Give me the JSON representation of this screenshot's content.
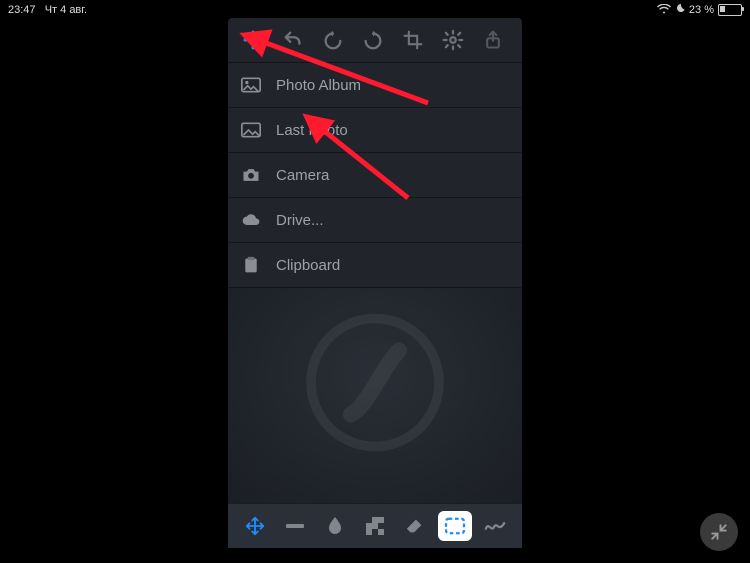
{
  "status": {
    "time": "23:47",
    "date": "Чт 4 авг.",
    "battery_text": "23 %",
    "battery_pct": 23
  },
  "toolbar": {
    "add": "Add",
    "undo": "Undo",
    "redo": "Redo",
    "crop": "Crop",
    "settings": "Settings",
    "share": "Share"
  },
  "menu": {
    "items": [
      {
        "icon": "image",
        "label": "Photo Album"
      },
      {
        "icon": "image",
        "label": "Last Photo"
      },
      {
        "icon": "camera",
        "label": "Camera"
      },
      {
        "icon": "cloud",
        "label": "Drive..."
      },
      {
        "icon": "clipboard",
        "label": "Clipboard"
      }
    ]
  },
  "bottom": {
    "tools": [
      "move",
      "line",
      "blur",
      "pixelate",
      "eraser",
      "marquee",
      "freehand"
    ],
    "selected_index": 5
  },
  "accent": "#1e8cff"
}
